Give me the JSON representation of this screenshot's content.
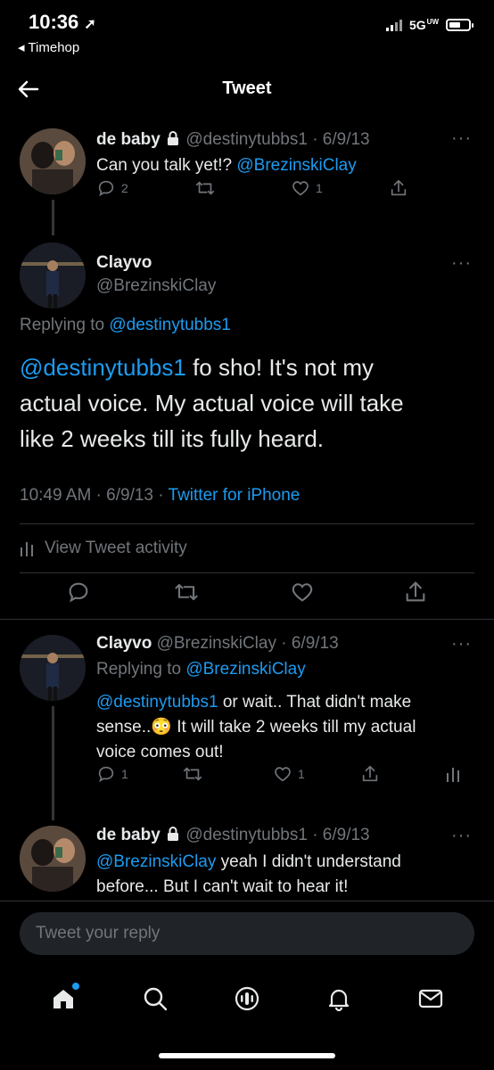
{
  "status_bar": {
    "time": "10:36",
    "back_app": "◂ Timehop",
    "network": "5G",
    "network_sup": "UW"
  },
  "header": {
    "title": "Tweet"
  },
  "tweet1": {
    "name": "de baby",
    "handle_date": "@destinytubbs1 · 6/9/13",
    "text_plain": "Can you talk yet!? ",
    "text_mention": "@BrezinskiClay",
    "replies": "2",
    "likes": "1"
  },
  "main_tweet": {
    "name": "Clayvo",
    "handle": "@BrezinskiClay",
    "replying_label": "Replying to ",
    "replying_to": "@destinytubbs1",
    "line1_mention": "@destinytubbs1",
    "line1_rest": " fo sho! It's not my",
    "line2": "actual voice. My actual voice will take",
    "line3": "like 2 weeks till its fully heard.",
    "time_date": "10:49 AM · 6/9/13 · ",
    "source": "Twitter for iPhone",
    "activity": "View Tweet activity"
  },
  "reply1": {
    "name": "Clayvo",
    "handle_date": "@BrezinskiClay · 6/9/13",
    "replying_label": "Replying to ",
    "replying_to": "@BrezinskiClay",
    "line1_mention": "@destinytubbs1",
    "line1_rest": " or wait.. That didn't make",
    "line2_a": "sense..",
    "line2_emoji": "😳",
    "line2_b": " It will take 2 weeks till my actual",
    "line3": "voice comes out!",
    "replies": "1",
    "likes": "1"
  },
  "reply2": {
    "name": "de baby",
    "handle_date": "@destinytubbs1 · 6/9/13",
    "line1_mention": "@BrezinskiClay",
    "line1_rest": " yeah I didn't understand",
    "line2": "before... But I can't wait to hear it!"
  },
  "reply_box": {
    "placeholder": "Tweet your reply"
  },
  "bottom_nav": [
    "home-icon",
    "search-icon",
    "spaces-icon",
    "notifications-icon",
    "messages-icon"
  ],
  "colors": {
    "accent": "#1d9bf0",
    "muted": "#71767b",
    "background": "#000000"
  }
}
